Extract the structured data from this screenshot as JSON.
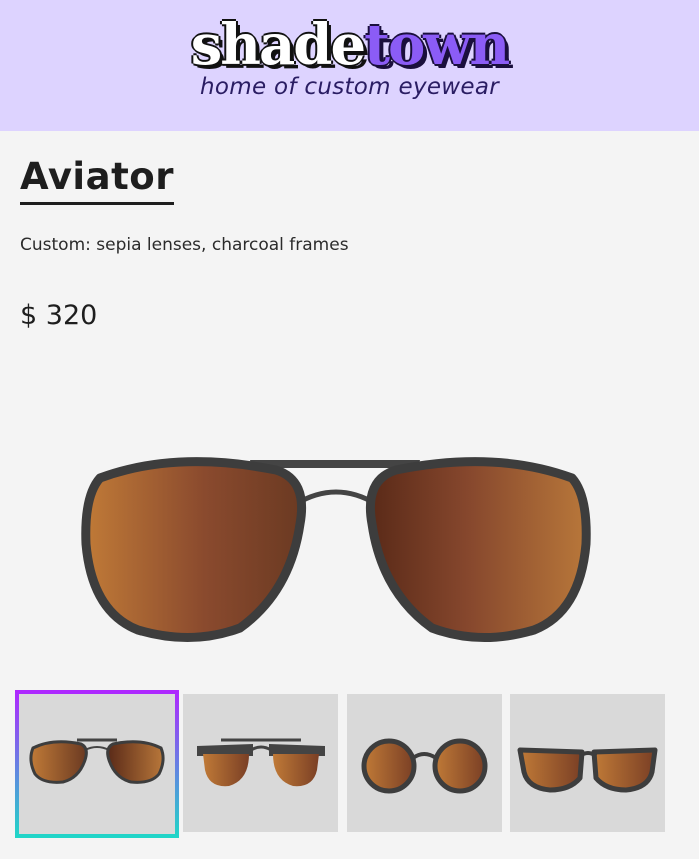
{
  "brand": {
    "logo_part1": "shade",
    "logo_part2": "town",
    "tagline": "home of custom eyewear",
    "header_color": "#ddd3ff",
    "accent_color": "#8b5cf6"
  },
  "product": {
    "name": "Aviator",
    "description": "Custom: sepia lenses, charcoal frames",
    "price": "$ 320",
    "lens_color": "sepia",
    "frame_color": "charcoal"
  },
  "gallery": {
    "thumbnails": [
      {
        "style": "aviator",
        "selected": true
      },
      {
        "style": "browline",
        "selected": false
      },
      {
        "style": "round",
        "selected": false
      },
      {
        "style": "wayfarer",
        "selected": false
      }
    ],
    "selected_border_gradient": [
      "#b026ff",
      "#1fd7c7"
    ]
  }
}
